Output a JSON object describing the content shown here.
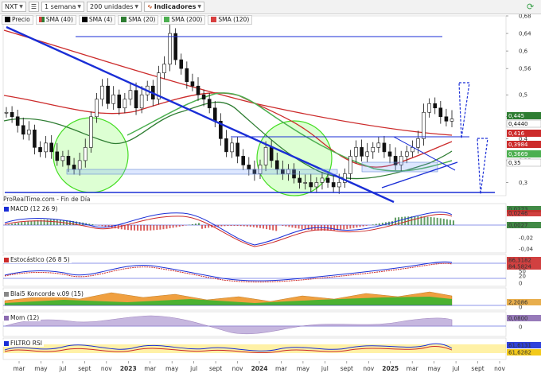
{
  "toolbar": {
    "symbol": "NXT",
    "timeframe": "1 semana",
    "units": "200 unidades",
    "indicators": "Indicadores"
  },
  "legend": [
    {
      "label": "Precio",
      "color": "#000000"
    },
    {
      "label": "SMA (40)",
      "color": "#d84040"
    },
    {
      "label": "SMA (4)",
      "color": "#000000"
    },
    {
      "label": "SMA (20)",
      "color": "#2e7d32"
    },
    {
      "label": "SMA (200)",
      "color": "#4caf50"
    },
    {
      "label": "SMA (120)",
      "color": "#d84040"
    }
  ],
  "watermark": "ProRealTime.com - Fin de Día",
  "colors": {
    "accent_blue": "#1a2ed6",
    "support_green": "#55dd22",
    "sma_red": "#cc2b2b",
    "sma_green": "#2e7d32"
  },
  "chart_data": [
    {
      "type": "candlestick",
      "title": "NXT",
      "ylim": [
        0.27,
        0.68
      ],
      "yticks": [
        "0,68",
        "0,64",
        "0,6",
        "0,56",
        "0,5",
        "0,45",
        "0,4",
        "0,35",
        "0,3"
      ],
      "price_tags": [
        {
          "label": "0,445",
          "color": "#2e7d32"
        },
        {
          "label": "0,4440",
          "color": "#ffffff"
        },
        {
          "label": "0,416",
          "color": "#cc2b2b"
        },
        {
          "label": "0,3984",
          "color": "#cc2b2b"
        },
        {
          "label": "0,3669",
          "color": "#4caf50"
        },
        {
          "label": "0,35",
          "color": "#ffffff"
        }
      ],
      "x_labels": [
        "mar",
        "may",
        "jul",
        "sept",
        "nov",
        "2023",
        "mar",
        "may",
        "jul",
        "sept",
        "nov",
        "2024",
        "mar",
        "may",
        "jul",
        "sept",
        "nov",
        "2025",
        "mar",
        "may",
        "jul",
        "sept",
        "nov"
      ],
      "close": [
        0.46,
        0.45,
        0.43,
        0.41,
        0.42,
        0.38,
        0.37,
        0.39,
        0.37,
        0.35,
        0.36,
        0.34,
        0.33,
        0.35,
        0.38,
        0.45,
        0.49,
        0.52,
        0.48,
        0.5,
        0.47,
        0.49,
        0.51,
        0.47,
        0.5,
        0.52,
        0.49,
        0.55,
        0.57,
        0.64,
        0.58,
        0.56,
        0.53,
        0.52,
        0.5,
        0.49,
        0.47,
        0.44,
        0.4,
        0.37,
        0.39,
        0.36,
        0.34,
        0.33,
        0.32,
        0.34,
        0.38,
        0.35,
        0.33,
        0.32,
        0.33,
        0.31,
        0.3,
        0.3,
        0.29,
        0.3,
        0.31,
        0.3,
        0.29,
        0.3,
        0.32,
        0.36,
        0.38,
        0.36,
        0.37,
        0.38,
        0.39,
        0.37,
        0.36,
        0.34,
        0.36,
        0.37,
        0.38,
        0.4,
        0.46,
        0.48,
        0.47,
        0.45,
        0.44,
        0.445
      ]
    },
    {
      "type": "line",
      "title": "MACD (12 26 9)",
      "yticks": [
        "0,0273",
        "0,0246",
        "0,0027",
        "-0,02",
        "-0,04"
      ]
    },
    {
      "type": "line",
      "title": "Estocástico (26 8 5)",
      "yticks": [
        "86,3182",
        "84,5824",
        "50",
        "20",
        "0"
      ]
    },
    {
      "type": "area",
      "title": "Blai5 Koncorde v.09 (15)",
      "yticks": [
        "2,2086",
        "0"
      ]
    },
    {
      "type": "area",
      "title": "Mom (12)",
      "yticks": [
        "0,0800",
        "0"
      ]
    },
    {
      "type": "line",
      "title": "FILTRO RSI",
      "yticks": [
        "61,6131",
        "61,6282"
      ]
    }
  ]
}
